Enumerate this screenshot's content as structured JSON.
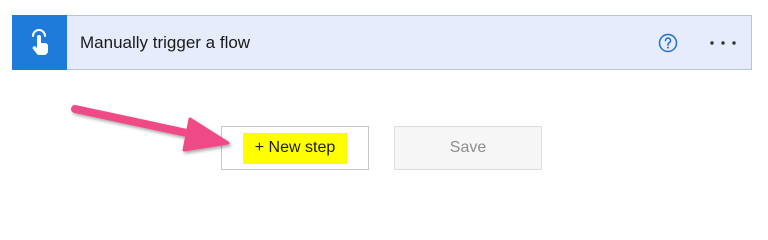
{
  "trigger": {
    "title": "Manually trigger a flow",
    "icon": "touch-hand-icon",
    "help_icon": "help-circle-icon",
    "more_icon": "more-ellipsis-icon",
    "accent_color": "#1f7bd9",
    "card_background": "#e6ecfb"
  },
  "actions": {
    "new_step_label": "+ New step",
    "new_step_highlight": "#ffff00",
    "save_label": "Save"
  },
  "annotation": {
    "arrow_color": "#ef4a86",
    "arrow_points_to": "new-step-button"
  }
}
